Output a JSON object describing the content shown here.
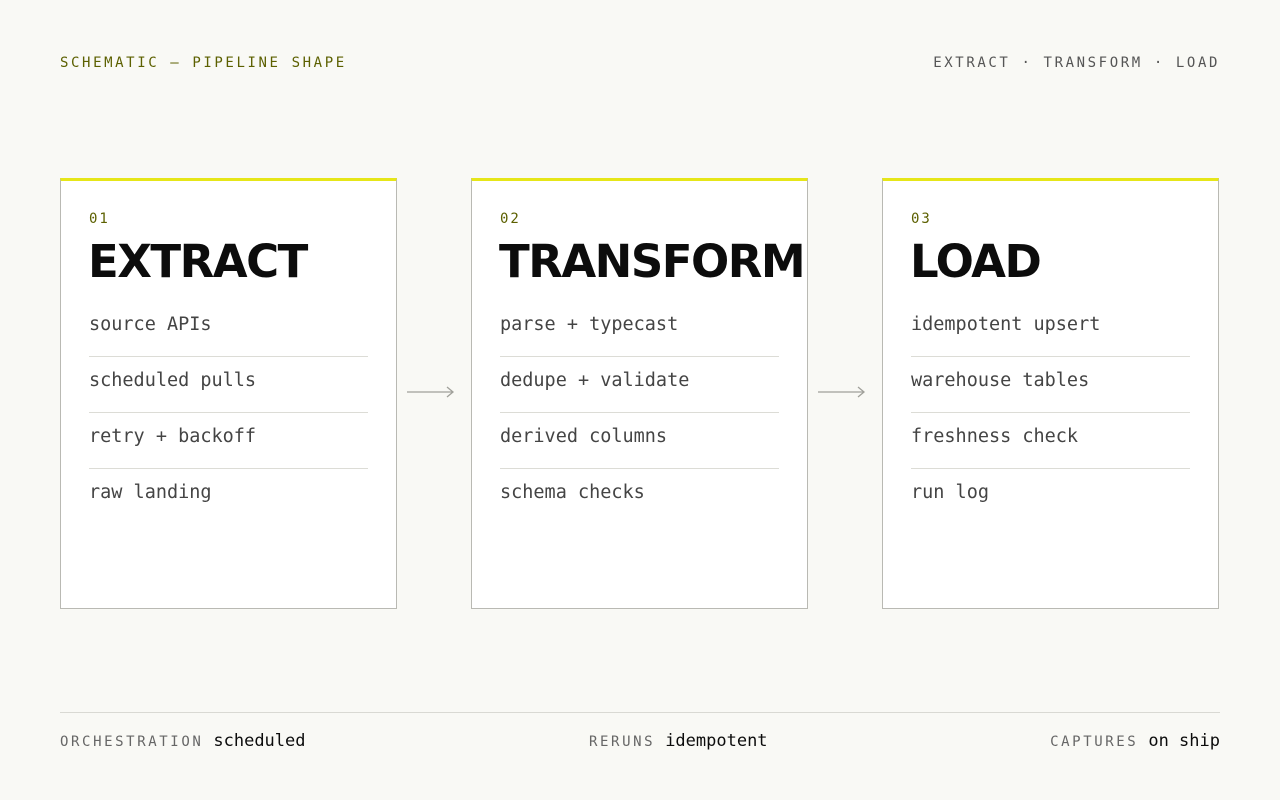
{
  "header": {
    "left": "SCHEMATIC — PIPELINE SHAPE",
    "right": "EXTRACT · TRANSFORM · LOAD"
  },
  "colors": {
    "accent": "#e6e618",
    "label": "#5c6000",
    "background": "#f9f9f5"
  },
  "stages": [
    {
      "num": "01",
      "title": "EXTRACT",
      "items": [
        "source APIs",
        "scheduled pulls",
        "retry + backoff",
        "raw landing"
      ]
    },
    {
      "num": "02",
      "title": "TRANSFORM",
      "items": [
        "parse + typecast",
        "dedupe + validate",
        "derived columns",
        "schema checks"
      ]
    },
    {
      "num": "03",
      "title": "LOAD",
      "items": [
        "idempotent upsert",
        "warehouse tables",
        "freshness check",
        "run log"
      ]
    }
  ],
  "footer": [
    {
      "key": "ORCHESTRATION",
      "value": "scheduled"
    },
    {
      "key": "RERUNS",
      "value": "idempotent"
    },
    {
      "key": "CAPTURES",
      "value": "on ship"
    }
  ]
}
